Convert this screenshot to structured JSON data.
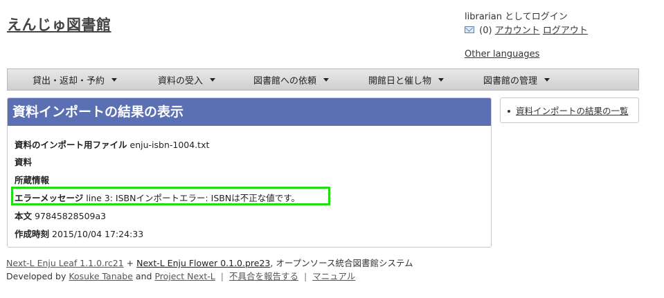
{
  "header": {
    "site_title": "えんじゅ図書館",
    "login_status": "librarian としてログイン",
    "message_count": "(0)",
    "account_link": "アカウント",
    "logout_link": "ログアウト",
    "other_languages": "Other languages"
  },
  "nav": {
    "items": [
      {
        "label": "貸出・返却・予約"
      },
      {
        "label": "資料の受入"
      },
      {
        "label": "図書館への依頼"
      },
      {
        "label": "開館日と催し物"
      },
      {
        "label": "図書館の管理"
      }
    ]
  },
  "main": {
    "title": "資料インポートの結果の表示",
    "fields": {
      "import_file_label": "資料のインポート用ファイル",
      "import_file_value": "enju-isbn-1004.txt",
      "resource_label": "資料",
      "item_label": "所蔵情報",
      "error_label": "エラーメッセージ",
      "error_value": "line 3: ISBNインポートエラー: ISBNは不正な値です。",
      "body_label": "本文",
      "body_value": "97845828509a3",
      "created_label": "作成時刻",
      "created_value": "2015/10/04 17:24:33"
    }
  },
  "sidebar": {
    "link": "資料インポートの結果の一覧"
  },
  "footer": {
    "leaf_link": "Next-L Enju Leaf 1.1.0.rc21",
    "plus": "+",
    "flower_link": "Next-L Enju Flower 0.1.0.pre23",
    "suffix": ", オープンソース統合図書館システム",
    "developed_by": "Developed by",
    "author_link": "Kosuke Tanabe",
    "and": "and",
    "project_link": "Project Next-L",
    "sep": "|",
    "report_link": "不具合を報告する",
    "manual_link": "マニュアル"
  },
  "colors": {
    "header_bar": "#5a70b3",
    "highlight": "#22dd11"
  }
}
